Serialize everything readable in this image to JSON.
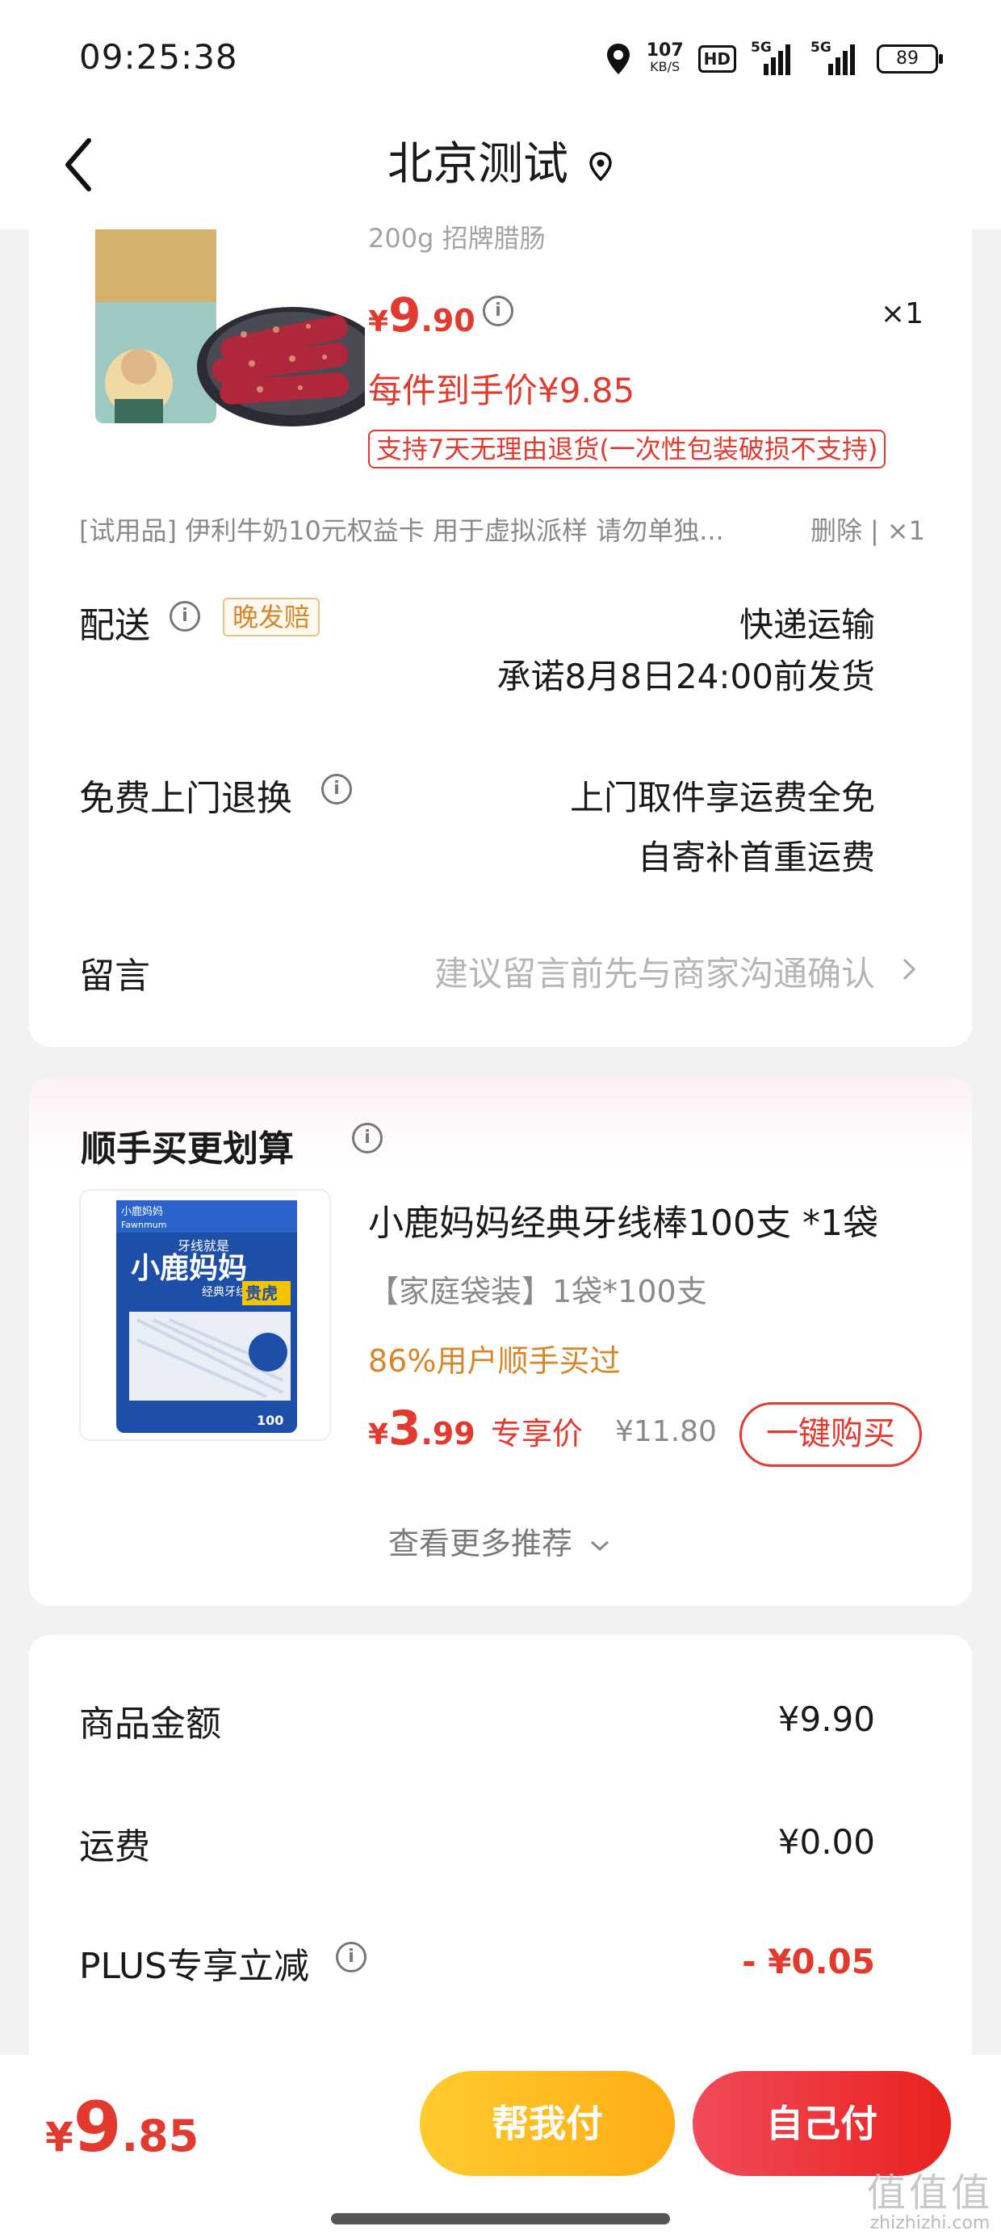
{
  "status_bar": {
    "time": "09:25:38",
    "net_speed": "107",
    "net_unit": "KB/S",
    "hd": "HD",
    "sig1": "5G",
    "sig2": "5G",
    "battery": "89"
  },
  "nav": {
    "title": "北京测试"
  },
  "order_item": {
    "name": "200g 招牌腊肠",
    "price_symbol": "¥",
    "price_int": "9",
    "price_dec": ".90",
    "qty": "×1",
    "final_price": "每件到手价¥9.85",
    "return_policy": "支持7天无理由退货(一次性包装破损不支持)"
  },
  "trial": {
    "text": "[试用品]  伊利牛奶10元权益卡 用于虚拟派样 请勿单独...",
    "delete": "删除",
    "qty": "×1"
  },
  "delivery": {
    "label": "配送",
    "badge": "晚发赔",
    "method": "快递运输",
    "promise": "承诺8月8日24:00前发货"
  },
  "return_service": {
    "label": "免费上门退换",
    "line1": "上门取件享运费全免",
    "line2": "自寄补首重运费"
  },
  "message": {
    "label": "留言",
    "placeholder": "建议留言前先与商家沟通确认"
  },
  "addon": {
    "title": "顺手买更划算",
    "product_name": "小鹿妈妈经典牙线棒100支 *1袋",
    "spec": "【家庭袋装】1袋*100支",
    "social": "86%用户顺手买过",
    "price_symbol": "¥",
    "price_int": "3",
    "price_dec": ".99",
    "price_tag": "专享价",
    "original_price": "¥11.80",
    "buy_label": "一键购买",
    "more": "查看更多推荐",
    "pkg_brand_small": "小鹿妈妈",
    "pkg_brand_en": "Fawnmum",
    "pkg_tagline": "牙线就是",
    "pkg_title": "小鹿妈妈",
    "pkg_sub": "经典牙线棒",
    "pkg_badge": "贵虎",
    "pkg_count": "100"
  },
  "summary": {
    "goods_label": "商品金额",
    "goods_value": "¥9.90",
    "shipping_label": "运费",
    "shipping_value": "¥0.00",
    "plus_label": "PLUS专享立减",
    "plus_value": "- ¥0.05"
  },
  "footer": {
    "symbol": "¥",
    "int": "9",
    "dec": ".85",
    "help_pay": "帮我付",
    "self_pay": "自己付",
    "wm_big": "值值值",
    "wm_small": "zhizhizhi.com"
  },
  "colors": {
    "accent_red": "#e23a2e",
    "yellow_btn": "#ffb81c",
    "orange_text": "#d9862a"
  }
}
